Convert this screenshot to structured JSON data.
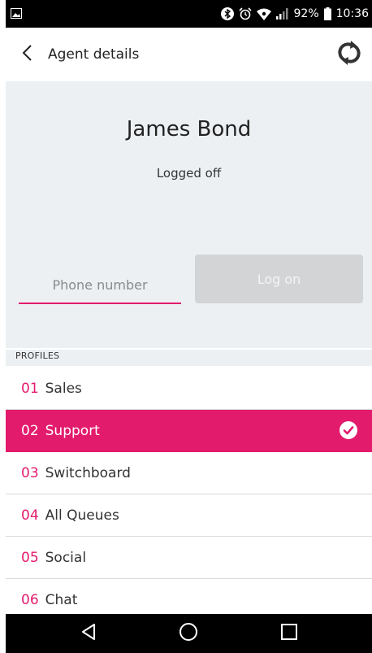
{
  "status_bar": {
    "battery": "92%",
    "time": "10:36",
    "icons": [
      "image-icon",
      "bluetooth-icon",
      "alarm-icon",
      "wifi-icon",
      "signal-icon",
      "battery-icon"
    ]
  },
  "header": {
    "title": "Agent details",
    "back_icon": "chevron-left-icon",
    "refresh_icon": "refresh-icon"
  },
  "agent": {
    "name": "James Bond",
    "status": "Logged off"
  },
  "login": {
    "phone_placeholder": "Phone number",
    "phone_value": "",
    "logon_label": "Log on"
  },
  "profiles": {
    "label": "PROFILES",
    "items": [
      {
        "num": "01",
        "label": "Sales",
        "selected": false
      },
      {
        "num": "02",
        "label": "Support",
        "selected": true
      },
      {
        "num": "03",
        "label": "Switchboard",
        "selected": false
      },
      {
        "num": "04",
        "label": "All Queues",
        "selected": false
      },
      {
        "num": "05",
        "label": "Social",
        "selected": false
      },
      {
        "num": "06",
        "label": "Chat",
        "selected": false
      }
    ]
  },
  "nav": {
    "icons": [
      "back-triangle-icon",
      "home-circle-icon",
      "recents-square-icon"
    ]
  },
  "colors": {
    "accent": "#e31b6d",
    "hero_bg": "#edf0f3",
    "button_disabled": "#d3d4d6"
  }
}
